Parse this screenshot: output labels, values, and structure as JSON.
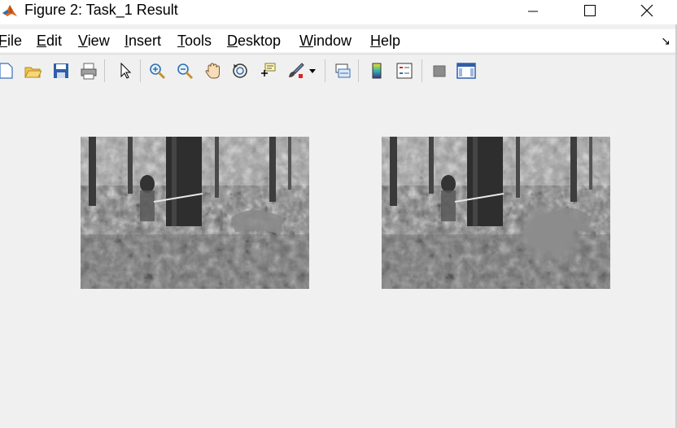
{
  "window": {
    "title": "Figure 2: Task_1 Result",
    "controls": [
      "minimize",
      "maximize",
      "close"
    ]
  },
  "menu": {
    "items": [
      {
        "pre": "",
        "ul": "F",
        "post": "ile"
      },
      {
        "pre": "",
        "ul": "E",
        "post": "dit"
      },
      {
        "pre": "",
        "ul": "V",
        "post": "iew"
      },
      {
        "pre": "",
        "ul": "I",
        "post": "nsert"
      },
      {
        "pre": "",
        "ul": "T",
        "post": "ools"
      },
      {
        "pre": "",
        "ul": "D",
        "post": "esktop"
      },
      {
        "pre": "",
        "ul": "W",
        "post": "indow"
      },
      {
        "pre": "",
        "ul": "H",
        "post": "elp"
      }
    ]
  },
  "toolbar": {
    "icons": [
      "new-figure-icon",
      "open-file-icon",
      "save-icon",
      "print-icon",
      "edit-plot-arrow-icon",
      "zoom-in-icon",
      "zoom-out-icon",
      "pan-hand-icon",
      "rotate-3d-icon",
      "data-cursor-icon",
      "brush-icon",
      "brush-dropdown-icon",
      "link-plot-icon",
      "insert-colorbar-icon",
      "insert-legend-icon",
      "hide-plot-tools-icon",
      "show-plot-tools-icon"
    ]
  },
  "axes": [
    {
      "name": "left-image",
      "content": "grayscale forest photo with person",
      "patch": "original"
    },
    {
      "name": "right-image",
      "content": "grayscale forest photo with person",
      "patch": "blurred-region"
    }
  ],
  "colors": {
    "titlebar": "#ffffff",
    "figure_bg": "#f0f0f0"
  }
}
